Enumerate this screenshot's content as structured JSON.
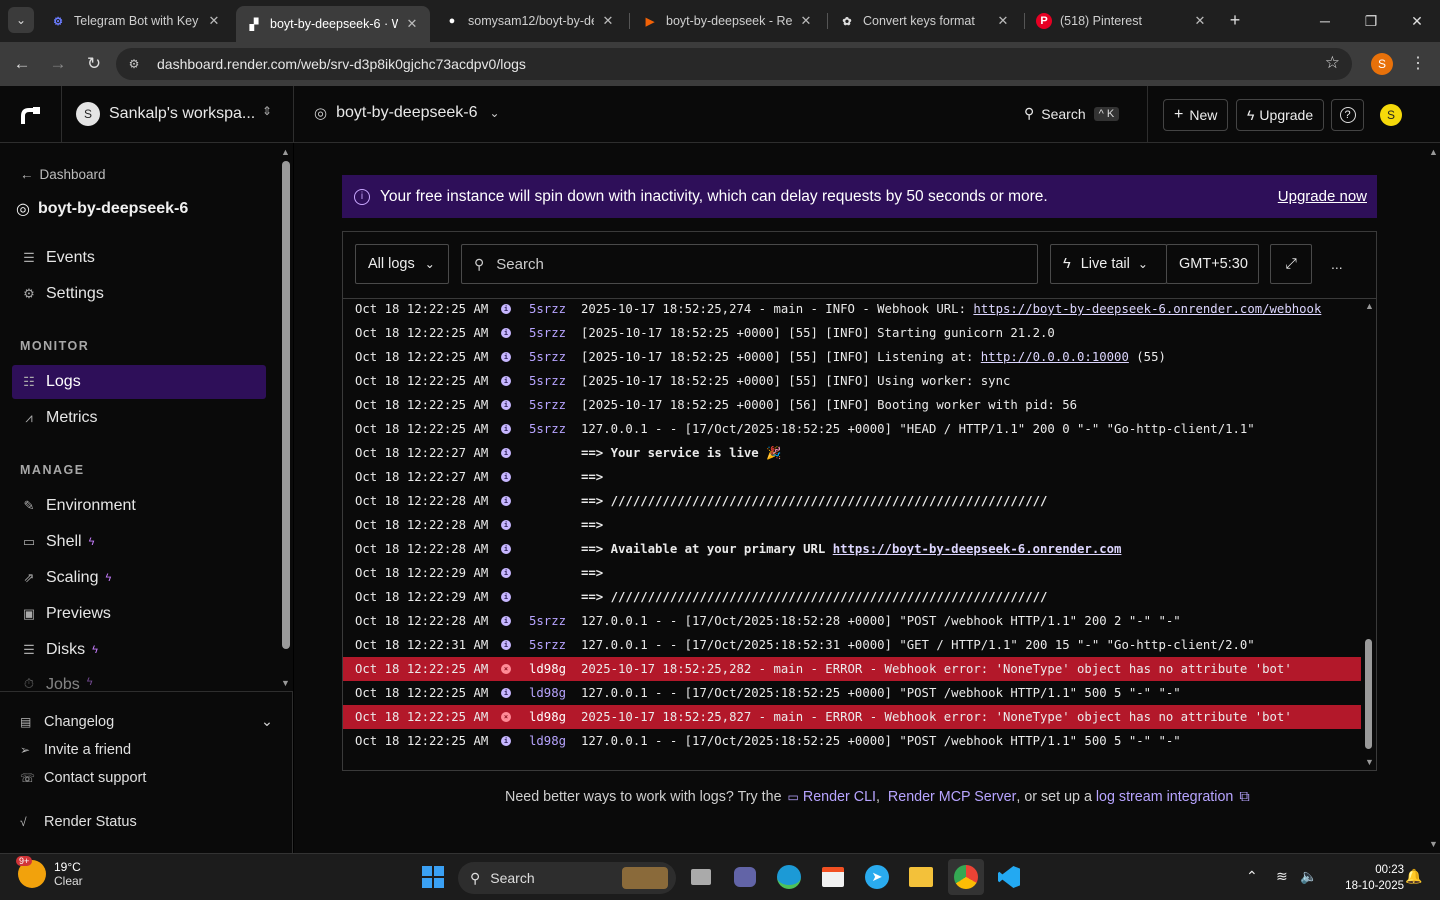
{
  "browser": {
    "tabs": [
      {
        "title": "Telegram Bot with Key D",
        "icon": "tg-bot-icon"
      },
      {
        "title": "boyt-by-deepseek-6 · W",
        "icon": "render-favicon"
      },
      {
        "title": "somysam12/boyt-by-de",
        "icon": "github-icon"
      },
      {
        "title": "boyt-by-deepseek - Rep",
        "icon": "replit-icon"
      },
      {
        "title": "Convert keys format",
        "icon": "chatgpt-icon"
      },
      {
        "title": "(518) Pinterest",
        "icon": "pinterest-icon"
      }
    ],
    "url": "dashboard.render.com/web/srv-d3p8ik0gjchc73acdpv0/logs",
    "profile_initial": "S"
  },
  "header": {
    "workspace_initial": "S",
    "workspace_name": "Sankalp's workspa...",
    "service_name": "boyt-by-deepseek-6",
    "search_label": "Search",
    "search_kbd": "^ K",
    "new_label": "New",
    "upgrade_label": "Upgrade",
    "help_icon": "?",
    "user_initial": "S"
  },
  "sidebar": {
    "back_label": "Dashboard",
    "service_name": "boyt-by-deepseek-6",
    "top_items": [
      {
        "label": "Events",
        "icon": "list-icon"
      },
      {
        "label": "Settings",
        "icon": "gear-icon"
      }
    ],
    "monitor_title": "MONITOR",
    "monitor_items": [
      {
        "label": "Logs",
        "icon": "logs-icon",
        "active": true
      },
      {
        "label": "Metrics",
        "icon": "chart-icon"
      }
    ],
    "manage_title": "MANAGE",
    "manage_items": [
      {
        "label": "Environment",
        "icon": "env-icon",
        "bolt": false
      },
      {
        "label": "Shell",
        "icon": "terminal-icon",
        "bolt": true
      },
      {
        "label": "Scaling",
        "icon": "scale-icon",
        "bolt": true
      },
      {
        "label": "Previews",
        "icon": "preview-icon",
        "bolt": false
      },
      {
        "label": "Disks",
        "icon": "disk-icon",
        "bolt": true
      },
      {
        "label": "Jobs",
        "icon": "jobs-icon",
        "bolt": true
      }
    ],
    "footer_items": [
      {
        "label": "Changelog",
        "icon": "changelog-icon"
      },
      {
        "label": "Invite a friend",
        "icon": "send-icon"
      },
      {
        "label": "Contact support",
        "icon": "support-icon"
      },
      {
        "label": "Render Status",
        "icon": "pulse-icon"
      }
    ]
  },
  "banner": {
    "text": "Your free instance will spin down with inactivity, which can delay requests by 50 seconds or more.",
    "link": "Upgrade now"
  },
  "toolbar": {
    "filter_label": "All logs",
    "search_placeholder": "Search",
    "live_tail_label": "Live tail",
    "timezone_label": "GMT+5:30",
    "more_label": "..."
  },
  "logs": [
    {
      "ts": "Oct 18 12:22:25 AM",
      "inst": "5srzz",
      "msg": "2025-10-17 18:52:25,274 - main - INFO - Webhook URL: ",
      "link": "https://boyt-by-deepseek-6.onrender.com/webhook",
      "after": "",
      "level": "info"
    },
    {
      "ts": "Oct 18 12:22:25 AM",
      "inst": "5srzz",
      "msg": "[2025-10-17 18:52:25 +0000] [55] [INFO] Starting gunicorn 21.2.0",
      "level": "info"
    },
    {
      "ts": "Oct 18 12:22:25 AM",
      "inst": "5srzz",
      "msg": "[2025-10-17 18:52:25 +0000] [55] [INFO] Listening at: ",
      "link": "http://0.0.0.0:10000",
      "after": " (55)",
      "level": "info"
    },
    {
      "ts": "Oct 18 12:22:25 AM",
      "inst": "5srzz",
      "msg": "[2025-10-17 18:52:25 +0000] [55] [INFO] Using worker: sync",
      "level": "info"
    },
    {
      "ts": "Oct 18 12:22:25 AM",
      "inst": "5srzz",
      "msg": "[2025-10-17 18:52:25 +0000] [56] [INFO] Booting worker with pid: 56",
      "level": "info"
    },
    {
      "ts": "Oct 18 12:22:25 AM",
      "inst": "5srzz",
      "msg": "127.0.0.1 - - [17/Oct/2025:18:52:25 +0000] \"HEAD / HTTP/1.1\" 200 0 \"-\" \"Go-http-client/1.1\"",
      "level": "info"
    },
    {
      "ts": "Oct 18 12:22:27 AM",
      "inst": "",
      "msg": "==> Your service is live 🎉",
      "bold": true,
      "level": "info"
    },
    {
      "ts": "Oct 18 12:22:27 AM",
      "inst": "",
      "msg": "==>",
      "bold": true,
      "level": "info"
    },
    {
      "ts": "Oct 18 12:22:28 AM",
      "inst": "",
      "msg": "==> ///////////////////////////////////////////////////////////",
      "bold": true,
      "level": "info"
    },
    {
      "ts": "Oct 18 12:22:28 AM",
      "inst": "",
      "msg": "==>",
      "bold": true,
      "level": "info"
    },
    {
      "ts": "Oct 18 12:22:28 AM",
      "inst": "",
      "msg": "==> Available at your primary URL ",
      "link": "https://boyt-by-deepseek-6.onrender.com",
      "after": "",
      "bold": true,
      "level": "info"
    },
    {
      "ts": "Oct 18 12:22:29 AM",
      "inst": "",
      "msg": "==>",
      "bold": true,
      "level": "info"
    },
    {
      "ts": "Oct 18 12:22:29 AM",
      "inst": "",
      "msg": "==> ///////////////////////////////////////////////////////////",
      "bold": true,
      "level": "info"
    },
    {
      "ts": "Oct 18 12:22:28 AM",
      "inst": "5srzz",
      "msg": "127.0.0.1 - - [17/Oct/2025:18:52:28 +0000] \"POST /webhook HTTP/1.1\" 200 2 \"-\" \"-\"",
      "level": "info"
    },
    {
      "ts": "Oct 18 12:22:31 AM",
      "inst": "5srzz",
      "msg": "127.0.0.1 - - [17/Oct/2025:18:52:31 +0000] \"GET / HTTP/1.1\" 200 15 \"-\" \"Go-http-client/2.0\"",
      "level": "info"
    },
    {
      "ts": "Oct 18 12:22:25 AM",
      "inst": "ld98g",
      "msg": "2025-10-17 18:52:25,282 - main - ERROR - Webhook error: 'NoneType' object has no attribute 'bot'",
      "level": "error"
    },
    {
      "ts": "Oct 18 12:22:25 AM",
      "inst": "ld98g",
      "msg": "127.0.0.1 - - [17/Oct/2025:18:52:25 +0000] \"POST /webhook HTTP/1.1\" 500 5 \"-\" \"-\"",
      "level": "info"
    },
    {
      "ts": "Oct 18 12:22:25 AM",
      "inst": "ld98g",
      "msg": "2025-10-17 18:52:25,827 - main - ERROR - Webhook error: 'NoneType' object has no attribute 'bot'",
      "level": "error"
    },
    {
      "ts": "Oct 18 12:22:25 AM",
      "inst": "ld98g",
      "msg": "127.0.0.1 - - [17/Oct/2025:18:52:25 +0000] \"POST /webhook HTTP/1.1\" 500 5 \"-\" \"-\"",
      "level": "info"
    }
  ],
  "footer_hint": {
    "prefix": "Need better ways to work with logs? Try the",
    "cli": "Render CLI",
    "mcp": "Render MCP Server",
    "mid": ", or set up a",
    "stream": "log stream integration"
  },
  "taskbar": {
    "weather_badge": "9+",
    "temp": "19°C",
    "condition": "Clear",
    "search_label": "Search",
    "time": "00:23",
    "date": "18-10-2025"
  },
  "colors": {
    "accent": "#2e0f59",
    "error_row": "#b3182a",
    "instance": "#b7a4ff"
  }
}
